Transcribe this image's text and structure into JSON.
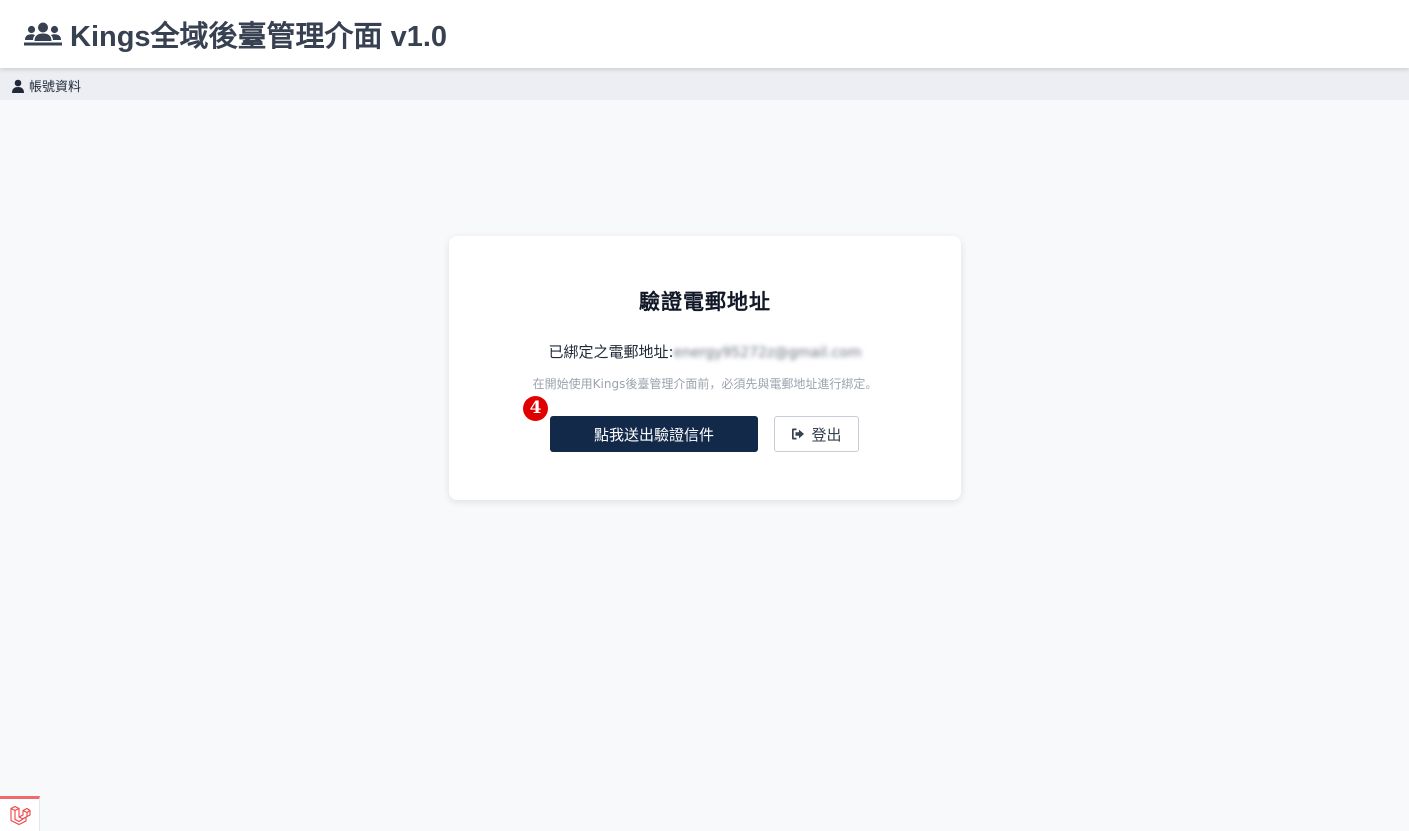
{
  "app": {
    "title": "Kings全域後臺管理介面 v1.0",
    "brand_icon": "users-icon"
  },
  "subnav": {
    "account_label": "帳號資料",
    "account_icon": "user-icon"
  },
  "card": {
    "title": "驗證電郵地址",
    "email_label": "已綁定之電郵地址:",
    "email_value": "energy95272z@gmail.com",
    "hint": "在開始使用Kings後臺管理介面前，必須先與電郵地址進行綁定。",
    "step_badge": "4",
    "send_button": "點我送出驗證信件",
    "logout_button": "登出",
    "logout_icon": "sign-out-icon"
  },
  "footer": {
    "corner_icon": "laravel-icon"
  },
  "colors": {
    "primary": "#12294a",
    "badge": "#e00000",
    "header_text": "#374151",
    "subnav_bg": "#eceef3",
    "page_bg": "#f8f9fb"
  }
}
